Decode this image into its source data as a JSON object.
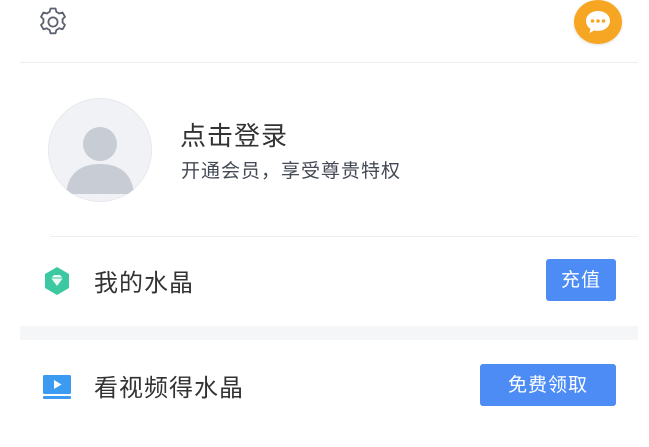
{
  "header": {
    "settings_icon": "gear-icon",
    "message_icon": "chat-bubble-icon",
    "accent_color": "#f6a623"
  },
  "profile": {
    "avatar_icon": "user-avatar-icon",
    "login_title": "点击登录",
    "login_subtitle": "开通会员，享受尊贵特权"
  },
  "crystal": {
    "icon": "gem-icon",
    "label": "我的水晶",
    "button_label": "充值"
  },
  "video_reward": {
    "icon": "monitor-play-icon",
    "label": "看视频得水晶",
    "button_label": "免费领取"
  },
  "colors": {
    "button_blue": "#4d8cf5",
    "gem_green": "#3cc8a0",
    "video_blue": "#3a9bf0"
  }
}
